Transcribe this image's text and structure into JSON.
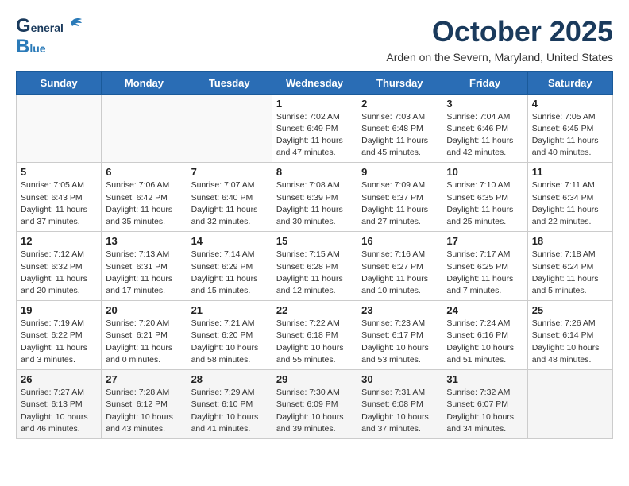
{
  "header": {
    "logo_g": "G",
    "logo_eneral": "eneral",
    "logo_b": "B",
    "logo_lue": "lue",
    "month": "October 2025",
    "location": "Arden on the Severn, Maryland, United States"
  },
  "days_of_week": [
    "Sunday",
    "Monday",
    "Tuesday",
    "Wednesday",
    "Thursday",
    "Friday",
    "Saturday"
  ],
  "weeks": [
    [
      {
        "day": "",
        "info": ""
      },
      {
        "day": "",
        "info": ""
      },
      {
        "day": "",
        "info": ""
      },
      {
        "day": "1",
        "info": "Sunrise: 7:02 AM\nSunset: 6:49 PM\nDaylight: 11 hours\nand 47 minutes."
      },
      {
        "day": "2",
        "info": "Sunrise: 7:03 AM\nSunset: 6:48 PM\nDaylight: 11 hours\nand 45 minutes."
      },
      {
        "day": "3",
        "info": "Sunrise: 7:04 AM\nSunset: 6:46 PM\nDaylight: 11 hours\nand 42 minutes."
      },
      {
        "day": "4",
        "info": "Sunrise: 7:05 AM\nSunset: 6:45 PM\nDaylight: 11 hours\nand 40 minutes."
      }
    ],
    [
      {
        "day": "5",
        "info": "Sunrise: 7:05 AM\nSunset: 6:43 PM\nDaylight: 11 hours\nand 37 minutes."
      },
      {
        "day": "6",
        "info": "Sunrise: 7:06 AM\nSunset: 6:42 PM\nDaylight: 11 hours\nand 35 minutes."
      },
      {
        "day": "7",
        "info": "Sunrise: 7:07 AM\nSunset: 6:40 PM\nDaylight: 11 hours\nand 32 minutes."
      },
      {
        "day": "8",
        "info": "Sunrise: 7:08 AM\nSunset: 6:39 PM\nDaylight: 11 hours\nand 30 minutes."
      },
      {
        "day": "9",
        "info": "Sunrise: 7:09 AM\nSunset: 6:37 PM\nDaylight: 11 hours\nand 27 minutes."
      },
      {
        "day": "10",
        "info": "Sunrise: 7:10 AM\nSunset: 6:35 PM\nDaylight: 11 hours\nand 25 minutes."
      },
      {
        "day": "11",
        "info": "Sunrise: 7:11 AM\nSunset: 6:34 PM\nDaylight: 11 hours\nand 22 minutes."
      }
    ],
    [
      {
        "day": "12",
        "info": "Sunrise: 7:12 AM\nSunset: 6:32 PM\nDaylight: 11 hours\nand 20 minutes."
      },
      {
        "day": "13",
        "info": "Sunrise: 7:13 AM\nSunset: 6:31 PM\nDaylight: 11 hours\nand 17 minutes."
      },
      {
        "day": "14",
        "info": "Sunrise: 7:14 AM\nSunset: 6:29 PM\nDaylight: 11 hours\nand 15 minutes."
      },
      {
        "day": "15",
        "info": "Sunrise: 7:15 AM\nSunset: 6:28 PM\nDaylight: 11 hours\nand 12 minutes."
      },
      {
        "day": "16",
        "info": "Sunrise: 7:16 AM\nSunset: 6:27 PM\nDaylight: 11 hours\nand 10 minutes."
      },
      {
        "day": "17",
        "info": "Sunrise: 7:17 AM\nSunset: 6:25 PM\nDaylight: 11 hours\nand 7 minutes."
      },
      {
        "day": "18",
        "info": "Sunrise: 7:18 AM\nSunset: 6:24 PM\nDaylight: 11 hours\nand 5 minutes."
      }
    ],
    [
      {
        "day": "19",
        "info": "Sunrise: 7:19 AM\nSunset: 6:22 PM\nDaylight: 11 hours\nand 3 minutes."
      },
      {
        "day": "20",
        "info": "Sunrise: 7:20 AM\nSunset: 6:21 PM\nDaylight: 11 hours\nand 0 minutes."
      },
      {
        "day": "21",
        "info": "Sunrise: 7:21 AM\nSunset: 6:20 PM\nDaylight: 10 hours\nand 58 minutes."
      },
      {
        "day": "22",
        "info": "Sunrise: 7:22 AM\nSunset: 6:18 PM\nDaylight: 10 hours\nand 55 minutes."
      },
      {
        "day": "23",
        "info": "Sunrise: 7:23 AM\nSunset: 6:17 PM\nDaylight: 10 hours\nand 53 minutes."
      },
      {
        "day": "24",
        "info": "Sunrise: 7:24 AM\nSunset: 6:16 PM\nDaylight: 10 hours\nand 51 minutes."
      },
      {
        "day": "25",
        "info": "Sunrise: 7:26 AM\nSunset: 6:14 PM\nDaylight: 10 hours\nand 48 minutes."
      }
    ],
    [
      {
        "day": "26",
        "info": "Sunrise: 7:27 AM\nSunset: 6:13 PM\nDaylight: 10 hours\nand 46 minutes."
      },
      {
        "day": "27",
        "info": "Sunrise: 7:28 AM\nSunset: 6:12 PM\nDaylight: 10 hours\nand 43 minutes."
      },
      {
        "day": "28",
        "info": "Sunrise: 7:29 AM\nSunset: 6:10 PM\nDaylight: 10 hours\nand 41 minutes."
      },
      {
        "day": "29",
        "info": "Sunrise: 7:30 AM\nSunset: 6:09 PM\nDaylight: 10 hours\nand 39 minutes."
      },
      {
        "day": "30",
        "info": "Sunrise: 7:31 AM\nSunset: 6:08 PM\nDaylight: 10 hours\nand 37 minutes."
      },
      {
        "day": "31",
        "info": "Sunrise: 7:32 AM\nSunset: 6:07 PM\nDaylight: 10 hours\nand 34 minutes."
      },
      {
        "day": "",
        "info": ""
      }
    ]
  ]
}
